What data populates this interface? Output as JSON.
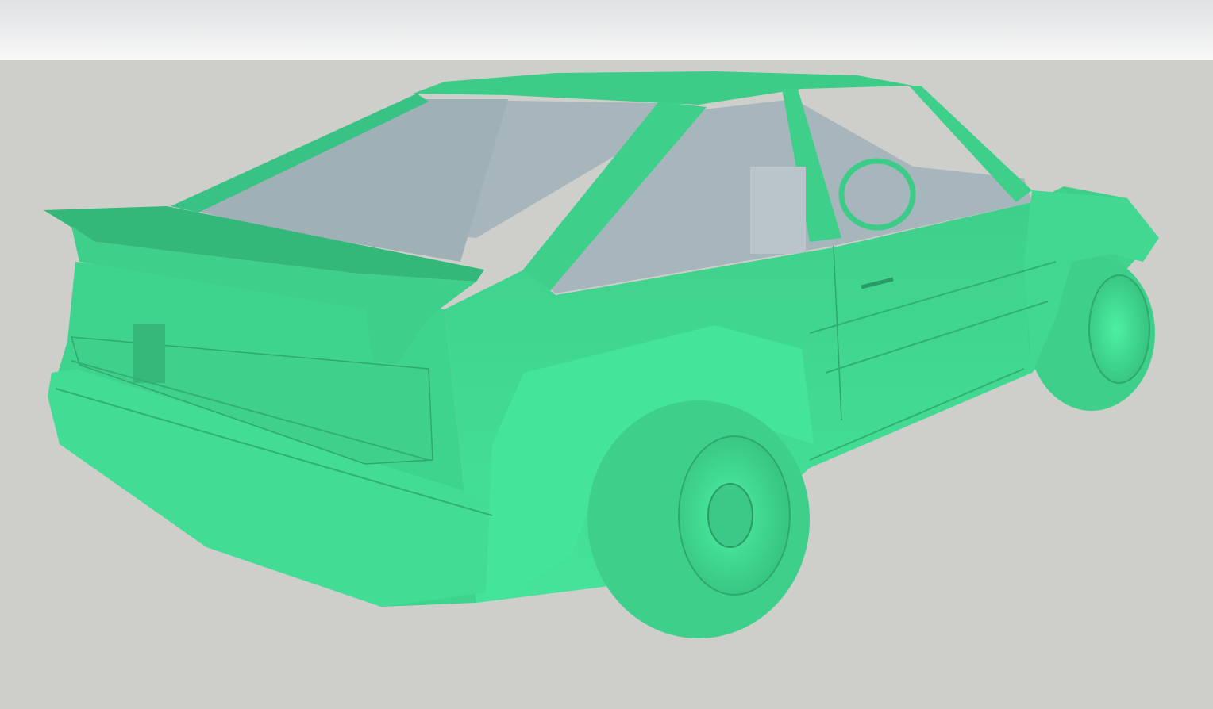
{
  "viewport": {
    "sky_color": "#eef0f1",
    "ground_color": "#cececa",
    "model_color": "#3ecf8a",
    "model_highlight": "#4aeea0",
    "model_shadow": "#2fa870",
    "glass_color": "#a9b7bd",
    "interior_color": "#b4c2c8"
  }
}
